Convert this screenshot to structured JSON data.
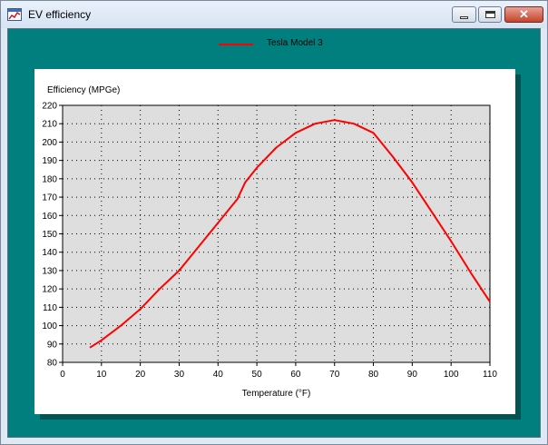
{
  "window": {
    "title": "EV efficiency",
    "close_glyph": "✕"
  },
  "legend": {
    "label": "Tesla Model 3",
    "color": "#ff0000"
  },
  "colors": {
    "client_bg": "#017f7f",
    "plot_bg": "#dedede",
    "panel_bg": "#ffffff"
  },
  "chart_data": {
    "type": "line",
    "ylabel": "Efficiency (MPGe)",
    "xlabel": "Temperature (°F)",
    "xlim": [
      0,
      110
    ],
    "ylim": [
      80,
      220
    ],
    "xticks": [
      0,
      10,
      20,
      30,
      40,
      50,
      60,
      70,
      80,
      90,
      100,
      110
    ],
    "yticks": [
      80,
      90,
      100,
      110,
      120,
      130,
      140,
      150,
      160,
      170,
      180,
      190,
      200,
      210,
      220
    ],
    "grid": true,
    "legend_position": "top-center",
    "series": [
      {
        "name": "Tesla Model 3",
        "color": "#ff0000",
        "x": [
          7,
          10,
          15,
          20,
          25,
          30,
          35,
          40,
          45,
          47,
          50,
          55,
          60,
          65,
          70,
          75,
          80,
          85,
          90,
          95,
          100,
          105,
          110
        ],
        "y": [
          88,
          92,
          100,
          109,
          120,
          130,
          143,
          156,
          169,
          178,
          186,
          197,
          205,
          210,
          212,
          210,
          205,
          192,
          178,
          162,
          146,
          129,
          113
        ]
      }
    ]
  }
}
